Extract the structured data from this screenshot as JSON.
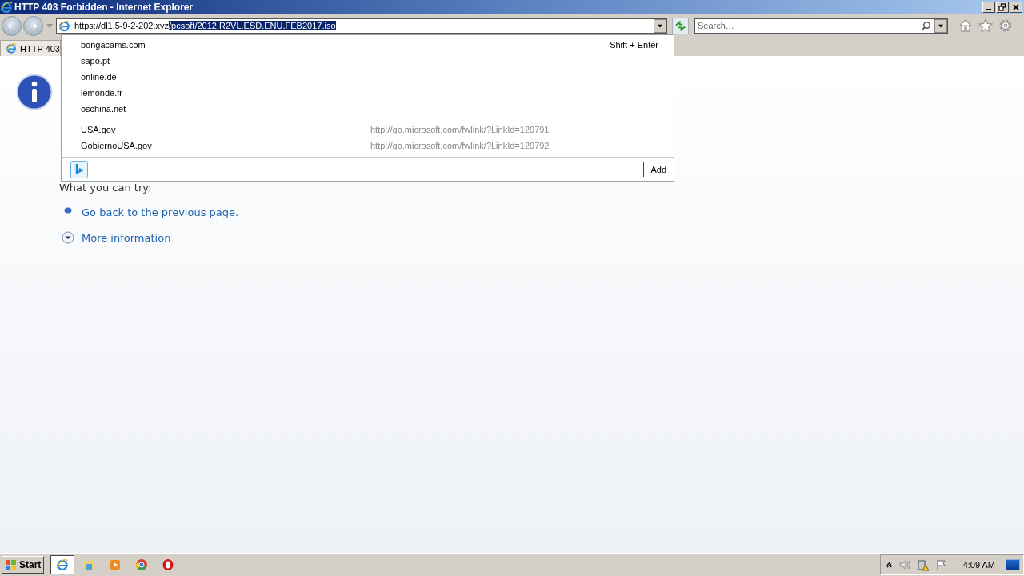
{
  "window": {
    "title": "HTTP 403 Forbidden - Internet Explorer"
  },
  "address": {
    "value": "https://dl1.5-9-2-202.xyz",
    "selected_value": "/pcsoft/2012.R2VL.ESD.ENU.FEB2017.iso"
  },
  "search": {
    "placeholder": "Search…"
  },
  "tabs": [
    {
      "label": "HTTP 403",
      "selected": true
    }
  ],
  "suggestions": {
    "history": [
      {
        "label": "bongacams.com",
        "shortcut": "Shift + Enter"
      },
      {
        "label": "sapo.pt"
      },
      {
        "label": "online.de"
      },
      {
        "label": "lemonde.fr"
      },
      {
        "label": "oschina.net"
      }
    ],
    "favorites": [
      {
        "label": "USA.gov",
        "url": "http://go.microsoft.com/fwlink/?LinkId=129791"
      },
      {
        "label": "GobiernoUSA.gov",
        "url": "http://go.microsoft.com/fwlink/?LinkId=129792"
      }
    ],
    "add_button": "Add"
  },
  "content": {
    "heading": "What you can try:",
    "links": [
      {
        "kind": "bullet",
        "text": "Go back to the previous page."
      },
      {
        "kind": "expand",
        "text": "More information"
      }
    ]
  },
  "taskbar": {
    "start": "Start",
    "apps": [
      {
        "kind": "ie",
        "selected": true
      },
      {
        "kind": "folder",
        "selected": false
      },
      {
        "kind": "media",
        "selected": false
      },
      {
        "kind": "chrome",
        "selected": false
      },
      {
        "kind": "opera",
        "selected": false
      }
    ],
    "clock": "4:09 AM"
  }
}
